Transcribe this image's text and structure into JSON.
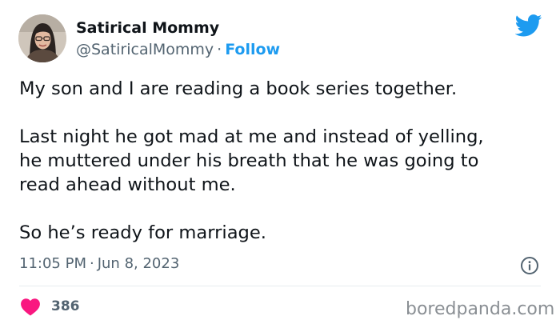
{
  "author": {
    "display_name": "Satirical Mommy",
    "handle": "@SatiricalMommy",
    "separator": "·",
    "follow_label": "Follow"
  },
  "tweet": {
    "paragraphs": [
      [
        "My son and I are reading a book series together."
      ],
      [
        "Last night he got mad at me and instead of yelling,",
        "he muttered under his breath that he was going to",
        "read ahead without me."
      ],
      [
        "So he’s ready for marriage."
      ]
    ],
    "time": "11:05 PM",
    "date": "Jun 8, 2023"
  },
  "engagement": {
    "likes": "386"
  },
  "watermark": "boredpanda.com",
  "icons": {
    "brand": "twitter-bird-icon",
    "info": "info-icon",
    "like": "heart-icon"
  },
  "colors": {
    "twitter_blue": "#1d9bf0",
    "heart_pink": "#f91880",
    "secondary_text": "#536471",
    "body_text": "#0f1419"
  }
}
